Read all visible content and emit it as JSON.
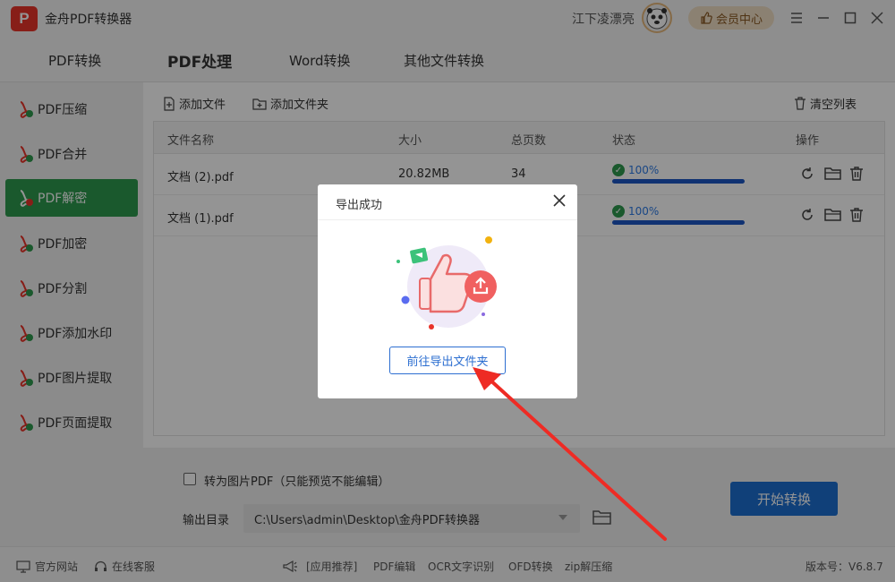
{
  "app": {
    "logo_letter": "P",
    "title": "金舟PDF转换器",
    "username": "江下凌漂亮",
    "vip_label": "会员中心"
  },
  "tabs": [
    {
      "label": "PDF转换"
    },
    {
      "label": "PDF处理",
      "active": true
    },
    {
      "label": "Word转换"
    },
    {
      "label": "其他文件转换"
    }
  ],
  "sidebar": {
    "items": [
      {
        "label": "PDF压缩"
      },
      {
        "label": "PDF合并"
      },
      {
        "label": "PDF解密",
        "active": true
      },
      {
        "label": "PDF加密"
      },
      {
        "label": "PDF分割"
      },
      {
        "label": "PDF添加水印"
      },
      {
        "label": "PDF图片提取"
      },
      {
        "label": "PDF页面提取"
      }
    ]
  },
  "toolbar": {
    "add_file": "添加文件",
    "add_folder": "添加文件夹",
    "clear_list": "清空列表"
  },
  "table": {
    "headers": {
      "name": "文件名称",
      "size": "大小",
      "pages": "总页数",
      "status": "状态",
      "ops": "操作"
    },
    "rows": [
      {
        "name": "文档 (2).pdf",
        "size": "20.82MB",
        "pages": "34",
        "status": "100%",
        "progress": 1.0
      },
      {
        "name": "文档 (1).pdf",
        "size": "",
        "pages": "",
        "status": "100%",
        "progress": 1.0
      }
    ]
  },
  "bottom": {
    "checkbox_label": "转为图片PDF（只能预览不能编辑）",
    "output_label": "输出目录",
    "output_path": "C:\\Users\\admin\\Desktop\\金舟PDF转换器",
    "start_button": "开始转换"
  },
  "statusbar": {
    "website": "官方网站",
    "service": "在线客服",
    "recommend": "[应用推荐]",
    "links": [
      "PDF编辑",
      "OCR文字识别",
      "OFD转换",
      "zip解压缩"
    ],
    "version": "版本号：V6.8.7"
  },
  "modal": {
    "title": "导出成功",
    "button": "前往导出文件夹"
  },
  "colors": {
    "sidebar_active": "#2d9a4e",
    "primary": "#1d6fd1",
    "progress": "#1d57c4",
    "annotation_arrow": "#ee2b24"
  }
}
